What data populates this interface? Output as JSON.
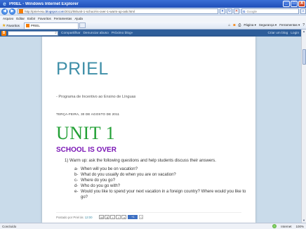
{
  "window": {
    "title": "PRIEL - Windows Internet Explorer",
    "minimize": "_",
    "maximize": "□",
    "close": "X"
  },
  "address": {
    "url_prefix": "http://priel-esu.",
    "url_host": "blogspot.com",
    "url_path": "/2011/08/unit-1-school-is-over-1-warm-up-ask.html",
    "search_placeholder": "Google"
  },
  "menu": [
    "Arquivo",
    "Editar",
    "Exibir",
    "Favoritos",
    "Ferramentas",
    "Ajuda"
  ],
  "favbar": {
    "favorites_label": "Favoritos",
    "tab_label": "PRIEL",
    "commands": [
      "Página ▾",
      "Segurança ▾",
      "Ferramentas ▾"
    ]
  },
  "blogger_nav": {
    "logo": "B",
    "links": [
      "Compartilhar",
      "Denunciar abuso",
      "Próximo blog»"
    ],
    "right": [
      "Criar um blog",
      "Login"
    ]
  },
  "blog": {
    "title": "PRIEL",
    "description": "- Programa de Incentivo ao Ensino de Línguas",
    "date_header": "TERÇA-FEIRA, 30 DE AGOSTO DE 2011",
    "unit_title": "UNIT 1",
    "post_title": "SCHOOL IS OVER",
    "intro": "1)  Warm up: ask the following questions and help students discuss their answers.",
    "questions": [
      {
        "letter": "a-",
        "text": "When will you be on vacation?"
      },
      {
        "letter": "b-",
        "text": "What do you usually do when you are on vacation?"
      },
      {
        "letter": "c-",
        "text": "Where do you go?"
      },
      {
        "letter": "d-",
        "text": "Who do you go with?"
      },
      {
        "letter": "e-",
        "text": "Would you like to spend your next vacation in a foreign country? Where would you like to go?"
      }
    ],
    "footer": {
      "posted_by": "Postado por Priel às",
      "time": "12:00",
      "gplus": "+1",
      "count": "0"
    }
  },
  "status": {
    "text": "Concluído",
    "zone": "Internet",
    "zoom": "100%"
  }
}
